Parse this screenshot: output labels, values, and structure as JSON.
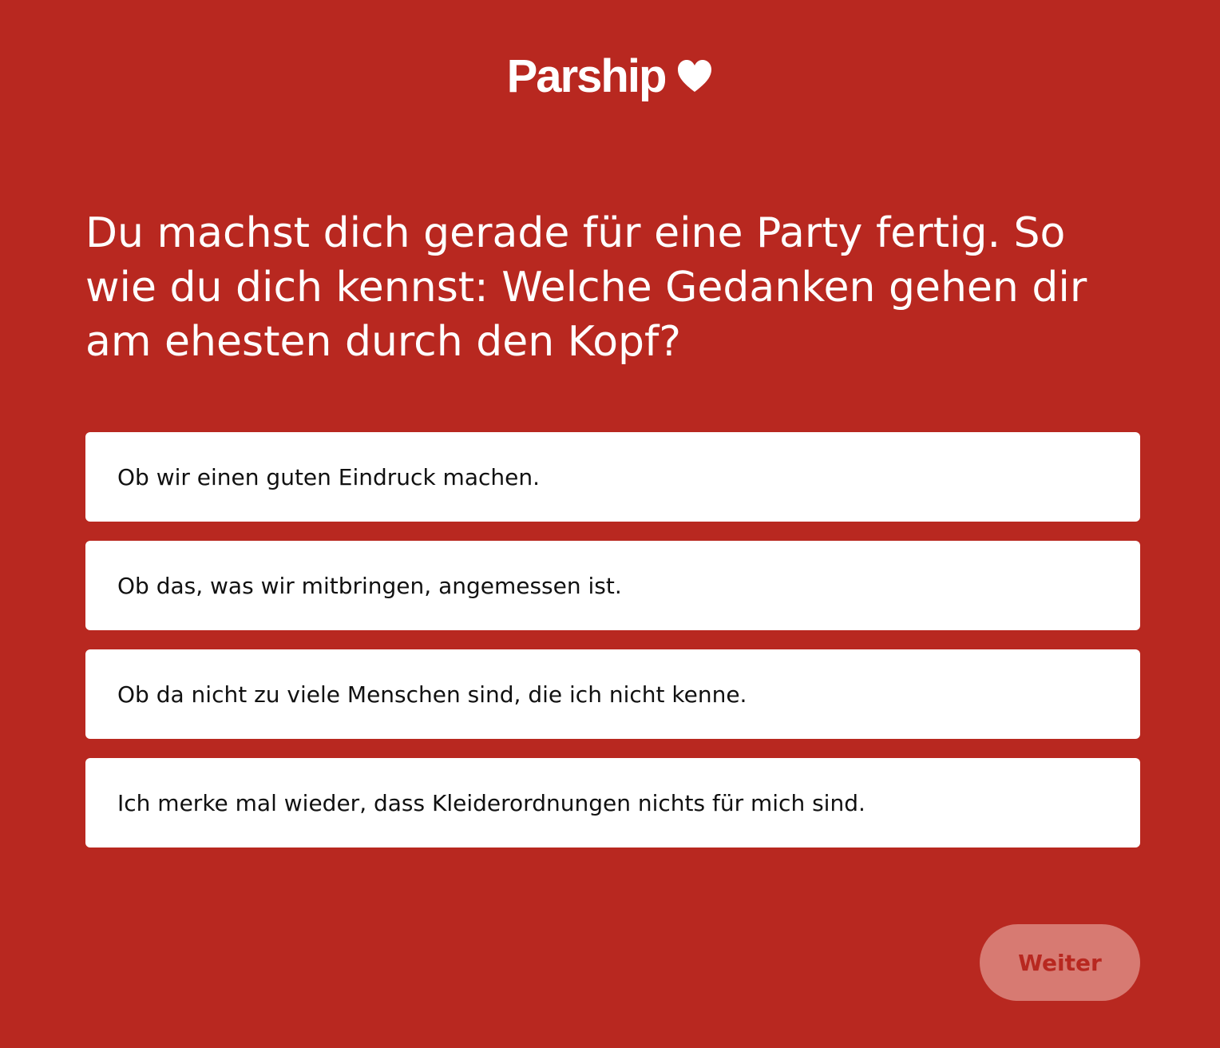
{
  "brand": {
    "logo_text": "Parship",
    "logo_icon": "heart-icon"
  },
  "question": {
    "text": "Du machst dich gerade für eine Party fertig. So wie du dich kennst: Welche Gedanken gehen dir am ehesten durch den Kopf?"
  },
  "options": [
    {
      "label": "Ob wir einen guten Eindruck machen."
    },
    {
      "label": "Ob das, was wir mitbringen, angemessen ist."
    },
    {
      "label": "Ob da nicht zu viele Menschen sind, die ich nicht kenne."
    },
    {
      "label": "Ich merke mal wieder, dass Kleiderordnungen nichts für mich sind."
    }
  ],
  "actions": {
    "next_label": "Weiter",
    "next_enabled": false
  },
  "colors": {
    "background": "#b82820",
    "option_background": "#ffffff",
    "button_disabled_background": "#d77a72",
    "button_text": "#b82820"
  }
}
